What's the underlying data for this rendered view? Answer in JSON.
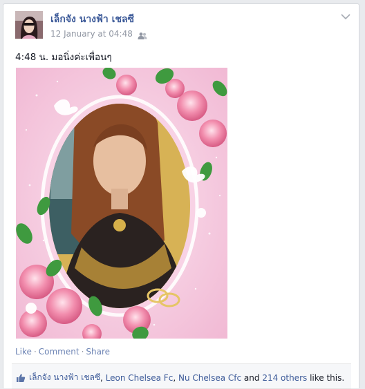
{
  "post": {
    "author": "เล็กจัง นางฟ้า เชลซี",
    "timestamp": "12 January at 04:48",
    "text": "4:48 น. มอนิ่งค่ะเพื่อนๆ",
    "audience_icon": "friends-icon",
    "menu_icon": "chevron-down-icon"
  },
  "actions": {
    "like": "Like",
    "comment": "Comment",
    "share": "Share",
    "separator": "·"
  },
  "likes": {
    "icon": "thumbs-up-icon",
    "names": [
      "เล็กจัง นางฟ้า เชลซี",
      "Leon Chelsea Fc",
      "Nu Chelsea Cfc"
    ],
    "comma": ",",
    "and_text": "and",
    "others": "214 others",
    "suffix": "like this."
  },
  "colors": {
    "link": "#3b5998",
    "meta": "#9197a3",
    "action_link": "#6d84b4",
    "photo_background": "#f3c6dc"
  }
}
